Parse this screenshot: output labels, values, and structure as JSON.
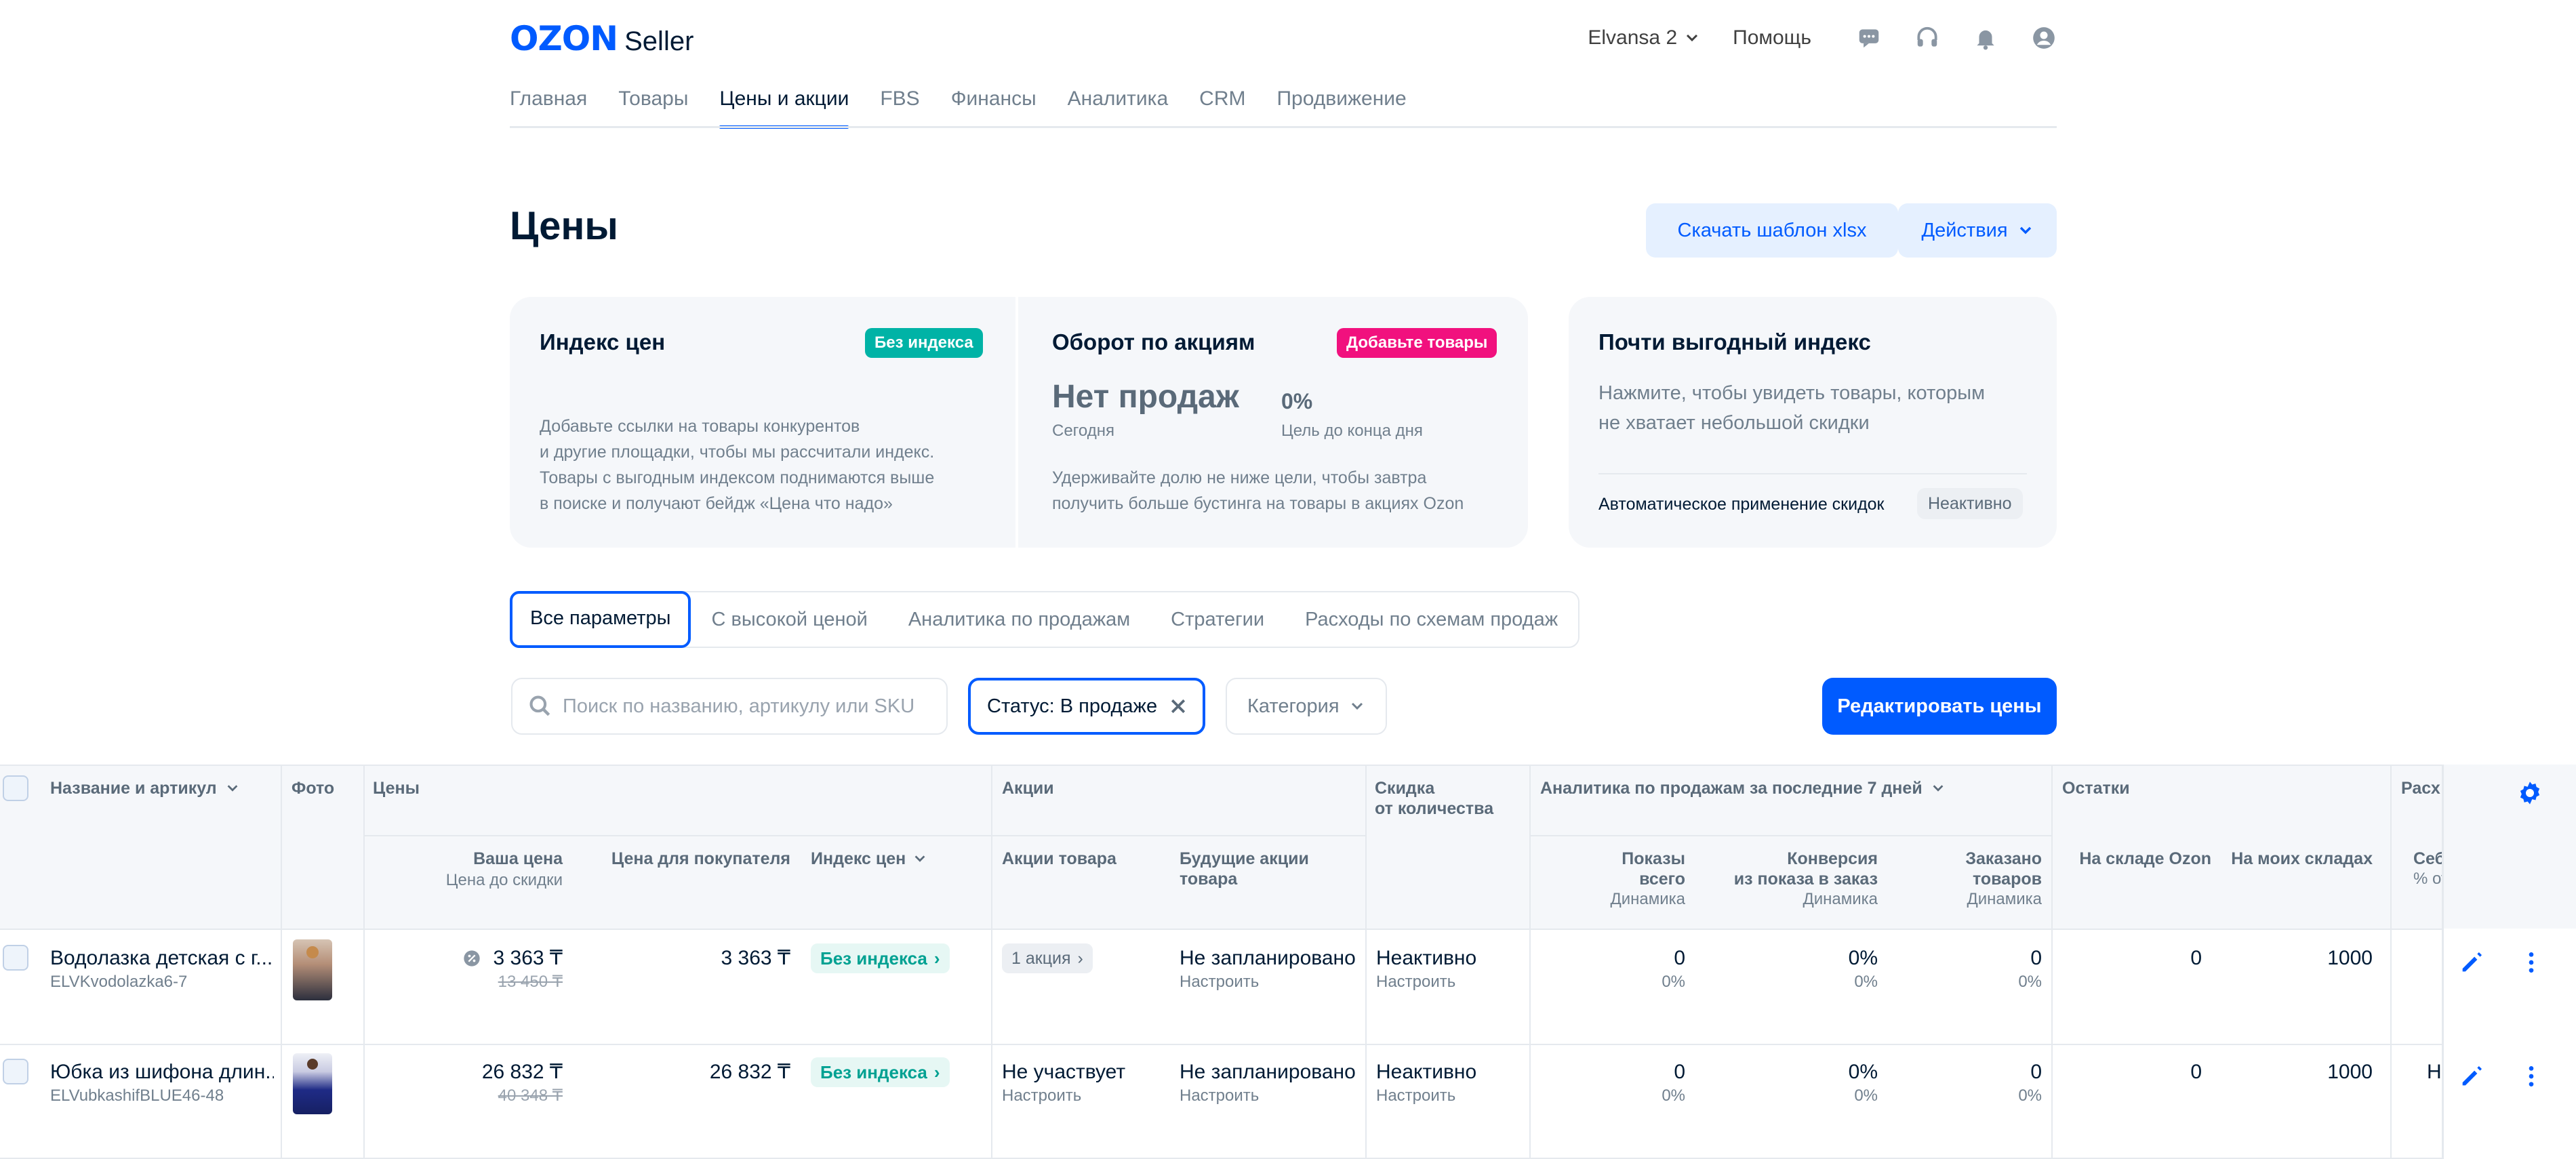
{
  "header": {
    "logo_brand": "OZON",
    "logo_product": "Seller",
    "account": "Elvansa 2",
    "help": "Помощь"
  },
  "nav": {
    "items": [
      "Главная",
      "Товары",
      "Цены и акции",
      "FBS",
      "Финансы",
      "Аналитика",
      "CRM",
      "Продвижение"
    ],
    "active": "Цены и акции"
  },
  "page": {
    "title": "Цены",
    "download_btn": "Скачать шаблон xlsx",
    "actions_btn": "Действия"
  },
  "cards": {
    "price_index": {
      "title": "Индекс цен",
      "badge": "Без индекса",
      "lines": [
        "Добавьте ссылки на товары конкурентов",
        "и другие площадки, чтобы мы рассчитали индекс.",
        "Товары с выгодным индексом поднимаются выше",
        "в поиске и получают бейдж «Цена что надо»"
      ]
    },
    "promo_turnover": {
      "title": "Оборот по акциям",
      "badge": "Добавьте товары",
      "big_value": "Нет продаж",
      "big_label": "Сегодня",
      "percent_value": "0%",
      "percent_label": "Цель до конца дня",
      "lines": [
        "Удерживайте долю не ниже цели, чтобы завтра",
        "получить больше бустинга на товары в акциях Ozon"
      ]
    },
    "almost_index": {
      "title": "Почти выгодный индекс",
      "lines": [
        "Нажмите, чтобы увидеть товары, которым",
        "не хватает небольшой скидки"
      ],
      "auto_label": "Автоматическое применение скидок",
      "auto_status": "Неактивно"
    }
  },
  "tabs": [
    "Все параметры",
    "С высокой ценой",
    "Аналитика по продажам",
    "Стратегии",
    "Расходы по схемам продаж"
  ],
  "filters": {
    "search_placeholder": "Поиск по названию, артикулу или SKU",
    "status_chip": "Статус: В продаже",
    "category": "Категория",
    "edit_btn": "Редактировать цены"
  },
  "table": {
    "col_name": "Название и артикул",
    "col_photo": "Фото",
    "grp_prices": "Цены",
    "grp_promos": "Акции",
    "grp_qty_discount": [
      "Скидка",
      "от количества"
    ],
    "grp_analytics": "Аналитика по продажам за последние 7 дней",
    "grp_stock": "Остатки",
    "grp_expenses": "Расхо",
    "your_price": "Ваша цена",
    "price_before": "Цена до скидки",
    "buyer_price": "Цена для покупателя",
    "price_index": "Индекс цен",
    "product_promos": "Акции товара",
    "future_promos": [
      "Будущие акции",
      "товара"
    ],
    "views": [
      "Показы",
      "всего",
      "Динамика"
    ],
    "conversion": [
      "Конверсия",
      "из показа в заказ",
      "Динамика"
    ],
    "ordered": [
      "Заказано",
      "товаров",
      "Динамика"
    ],
    "stock_ozon": "На складе Ozon",
    "stock_mine": "На моих складах",
    "cost": [
      "Себ",
      "% от"
    ],
    "rows": [
      {
        "name": "Водолазка детская с г...",
        "sku": "ELVKvodolazka6-7",
        "price": "3 363 ₸",
        "old_price": "13 450 ₸",
        "buyer_price": "3 363 ₸",
        "index": "Без индекса",
        "promos": "1 акция",
        "promos_sub": "",
        "future": "Не запланировано",
        "future_sub": "Настроить",
        "qty": "Неактивно",
        "qty_sub": "Настроить",
        "views": "0",
        "views_dyn": "0%",
        "conv": "0%",
        "conv_dyn": "0%",
        "ordered": "0",
        "ordered_dyn": "0%",
        "stock_ozon": "0",
        "stock_mine": "1000",
        "cost": ""
      },
      {
        "name": "Юбка из шифона длин...",
        "sku": "ELVubkashifBLUE46-48",
        "price": "26 832 ₸",
        "old_price": "40 348 ₸",
        "buyer_price": "26 832 ₸",
        "index": "Без индекса",
        "promos": "Не участвует",
        "promos_sub": "Настроить",
        "future": "Не запланировано",
        "future_sub": "Настроить",
        "qty": "Неактивно",
        "qty_sub": "Настроить",
        "views": "0",
        "views_dyn": "0%",
        "conv": "0%",
        "conv_dyn": "0%",
        "ordered": "0",
        "ordered_dyn": "0%",
        "stock_ozon": "0",
        "stock_mine": "1000",
        "cost": "Н"
      }
    ]
  },
  "colors": {
    "brand": "#005bff",
    "index_badge": "#00b3a6",
    "warn_badge": "#f1117e"
  }
}
